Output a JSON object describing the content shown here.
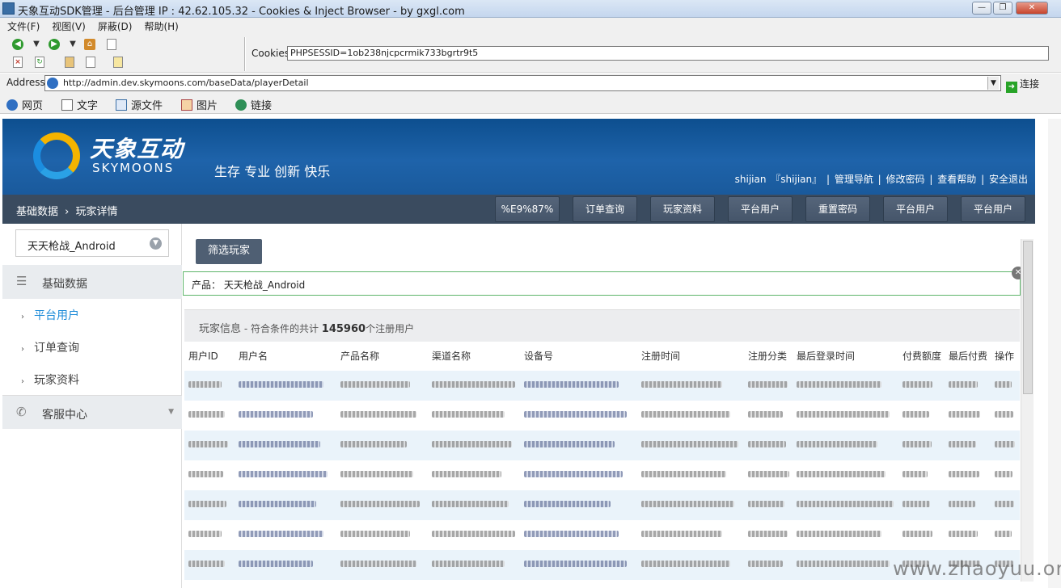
{
  "window": {
    "title": "天象互动SDK管理 - 后台管理 IP : 42.62.105.32 - Cookies & Inject Browser - by gxgl.com",
    "minimize_label": "—",
    "restore_label": "❐",
    "close_label": "✕"
  },
  "menu": [
    "文件(F)",
    "视图(V)",
    "屏蔽(D)",
    "帮助(H)"
  ],
  "cookies": {
    "label": "Cookies:",
    "value": "PHPSESSID=1ob238njcpcrmik733bgrtr9t5"
  },
  "address": {
    "label": "Address:",
    "url": "http://admin.dev.skymoons.com/baseData/playerDetail",
    "go_label": "连接",
    "go_icon": "arrow-right-icon"
  },
  "view_tabs": [
    {
      "label": "网页",
      "icon": "ie-icon"
    },
    {
      "label": "文字",
      "icon": "page-icon"
    },
    {
      "label": "源文件",
      "icon": "source-icon"
    },
    {
      "label": "图片",
      "icon": "image-icon"
    },
    {
      "label": "链接",
      "icon": "globe-icon"
    }
  ],
  "brand": {
    "name_cn": "天象互动",
    "name_en": "SKYMOONS",
    "slogan": "生存 专业 创新 快乐"
  },
  "user_nav": {
    "user": "shijian",
    "role": "『shijian』",
    "links": [
      "管理导航",
      "修改密码",
      "查看帮助",
      "安全退出"
    ],
    "sep": "|"
  },
  "breadcrumb": {
    "parent": "基础数据",
    "arrow": "›",
    "current": "玩家详情"
  },
  "nav_buttons": [
    "%E9%87%",
    "订单查询",
    "玩家资料",
    "平台用户",
    "重置密码",
    "平台用户",
    "平台用户"
  ],
  "sidebar": {
    "product": "天天枪战_Android",
    "sections": [
      {
        "label": "基础数据",
        "icon": "list-icon",
        "items": [
          "平台用户",
          "订单查询",
          "玩家资料"
        ],
        "active": "平台用户"
      },
      {
        "label": "客服中心",
        "icon": "phone-icon"
      }
    ]
  },
  "main": {
    "filter_button": "筛选玩家",
    "product_tag": {
      "label": "产品：",
      "value": "天天枪战_Android"
    },
    "panel": {
      "title": "玩家信息",
      "prefix": " - 符合条件的共计 ",
      "count": "145960",
      "suffix": "个注册用户"
    },
    "columns": [
      "用户ID",
      "用户名",
      "产品名称",
      "渠道名称",
      "设备号",
      "注册时间",
      "注册分类",
      "最后登录时间",
      "付费额度",
      "最后付费",
      "操作"
    ]
  },
  "colors": {
    "banner": "#1a5a9c",
    "navbar": "#3a4b5f",
    "active_link": "#1a8ad8",
    "row_alt": "#eaf3fa"
  },
  "watermark": "www.zhaoyuu.org"
}
